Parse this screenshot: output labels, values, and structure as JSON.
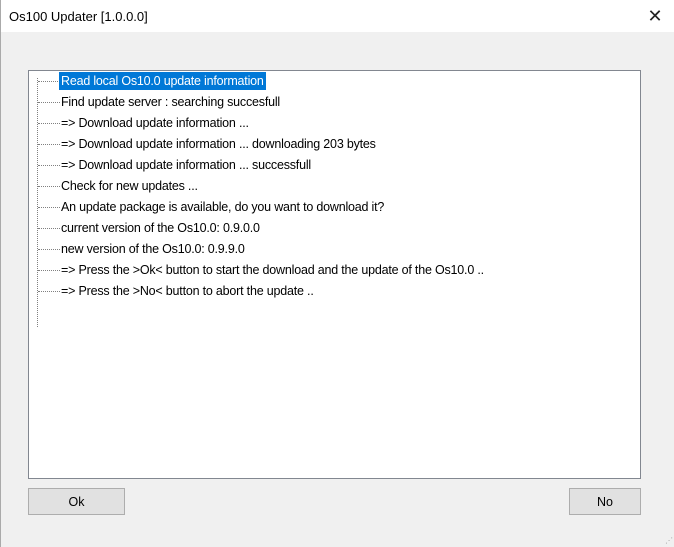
{
  "window": {
    "title": "Os100 Updater [1.0.0.0]",
    "close_glyph": "✕"
  },
  "tree": {
    "items": [
      {
        "label": "Read local Os10.0 update information",
        "selected": true
      },
      {
        "label": "Find update server : searching  succesfull"
      },
      {
        "label": " => Download update information ..."
      },
      {
        "label": " => Download update information ... downloading 203 bytes"
      },
      {
        "label": " => Download update information ... successfull"
      },
      {
        "label": "Check for new updates ..."
      },
      {
        "label": "An update package is available, do you want to download it?"
      },
      {
        "label": "  current version of the Os10.0: 0.9.0.0"
      },
      {
        "label": "  new version of the Os10.0: 0.9.9.0"
      },
      {
        "label": "   => Press the >Ok< button to start the download and the update of the Os10.0 .."
      },
      {
        "label": "   => Press the >No< button to abort the update .."
      }
    ]
  },
  "buttons": {
    "ok_label": "Ok",
    "no_label": "No"
  },
  "colors": {
    "selection": "#0078d7",
    "dialog_bg": "#f0f0f0",
    "button_bg": "#e1e1e1"
  },
  "icons": {
    "close": "close-icon",
    "resize": "resize-grip-icon"
  }
}
